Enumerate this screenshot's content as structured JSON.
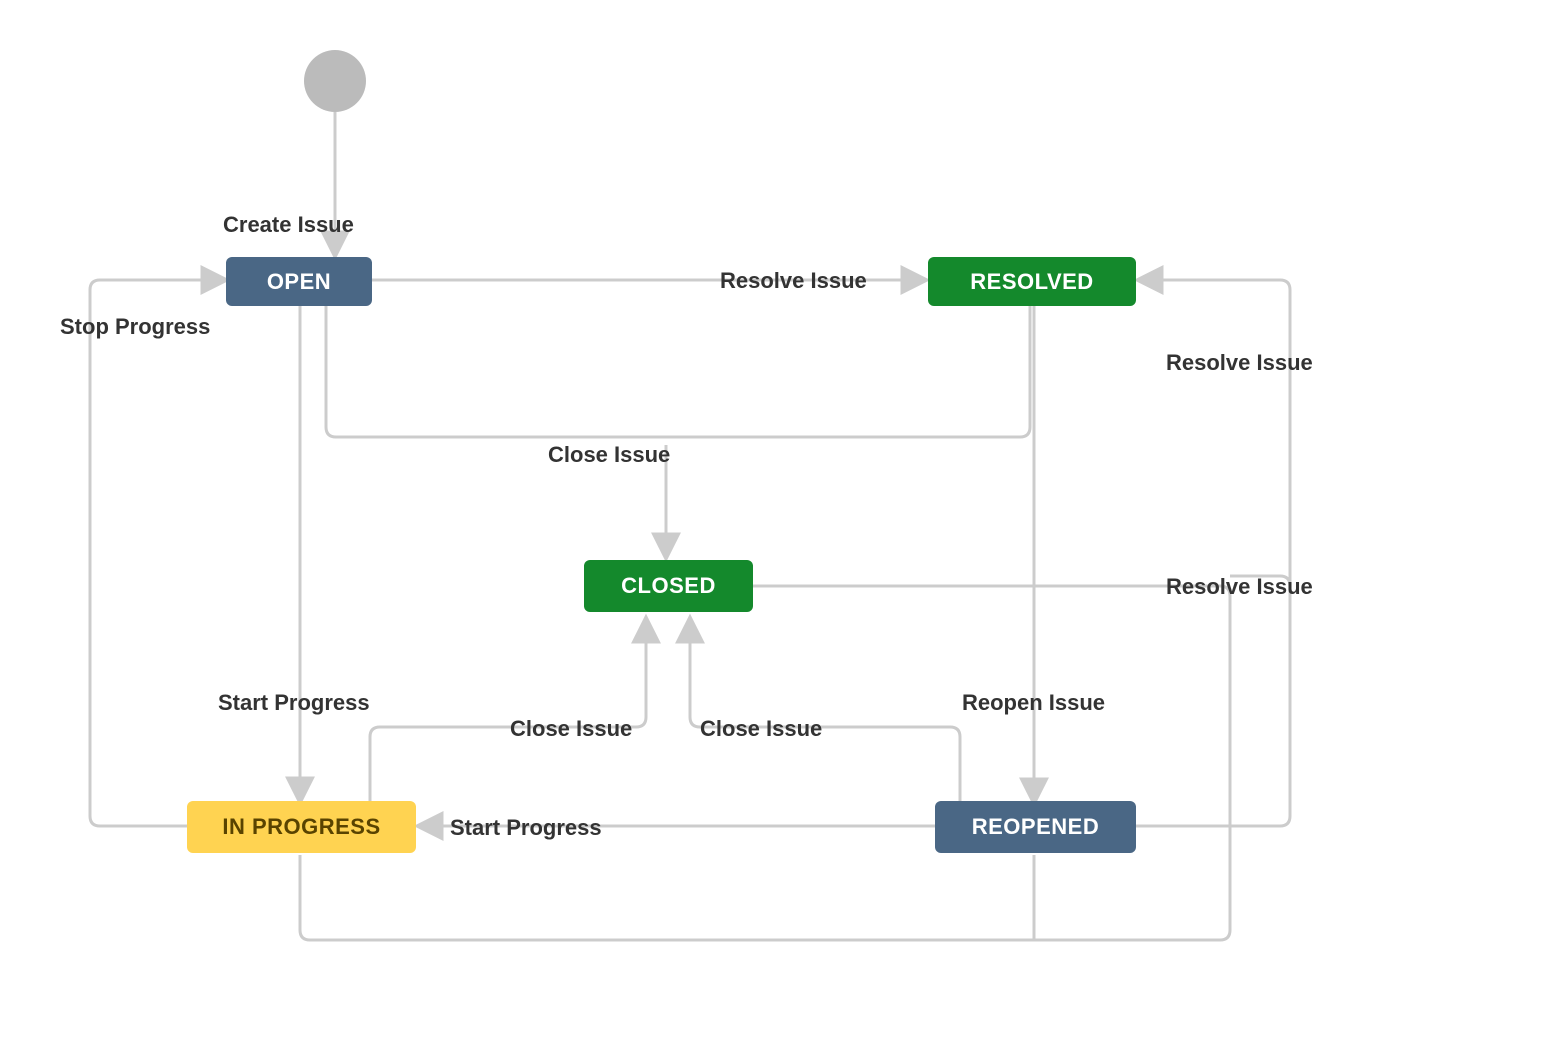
{
  "states": {
    "open": "OPEN",
    "resolved": "RESOLVED",
    "closed": "CLOSED",
    "in_progress": "IN PROGRESS",
    "reopened": "REOPENED"
  },
  "transitions": {
    "create_issue": "Create Issue",
    "stop_progress": "Stop Progress",
    "resolve_issue_1": "Resolve Issue",
    "resolve_issue_2": "Resolve Issue",
    "resolve_issue_3": "Resolve Issue",
    "close_issue_1": "Close Issue",
    "close_issue_2": "Close Issue",
    "close_issue_3": "Close Issue",
    "start_progress_1": "Start Progress",
    "start_progress_2": "Start Progress",
    "reopen_issue": "Reopen Issue"
  },
  "colors": {
    "stroke": "#cccccc",
    "arrow": "#cccccc",
    "start_dot": "#bbbbbb",
    "text": "#333333",
    "blue": "#4a6785",
    "green": "#14892c",
    "yellow": "#ffd351",
    "yellow_text": "#594300"
  }
}
